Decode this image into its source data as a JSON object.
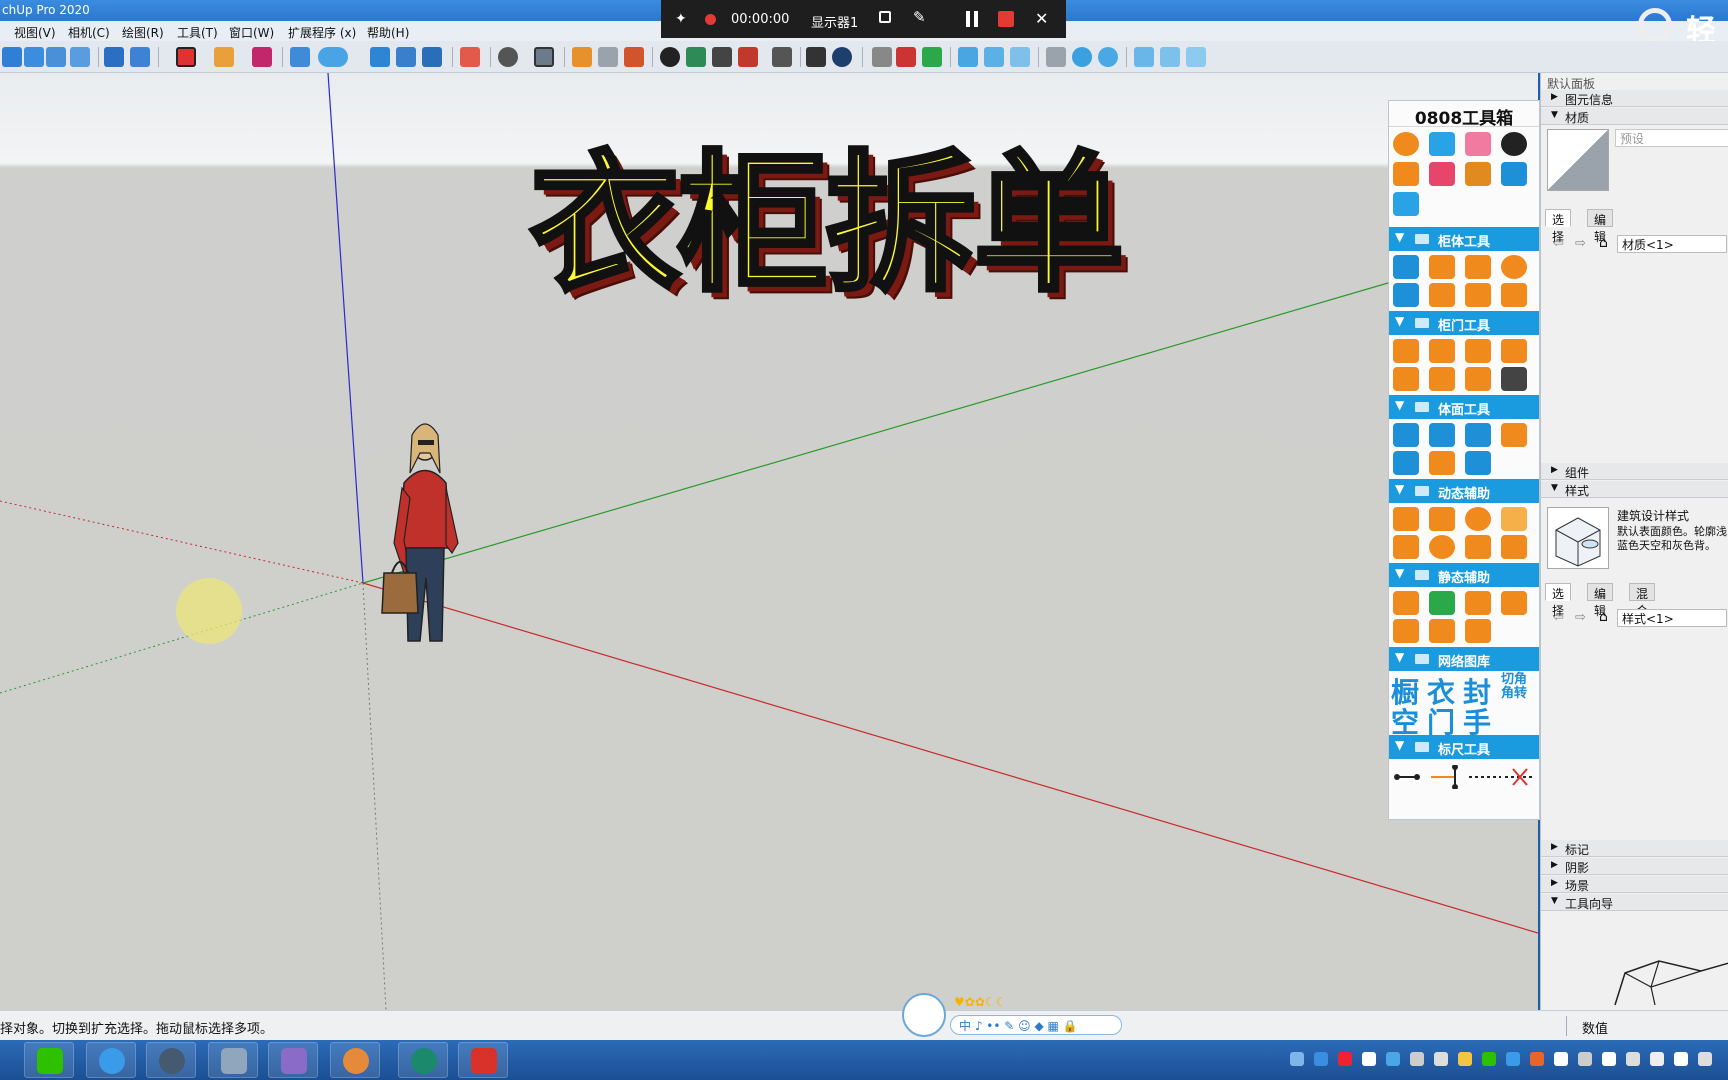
{
  "window": {
    "title": "chUp Pro 2020",
    "brand": "轻"
  },
  "menu": [
    "视图(V)",
    "相机(C)",
    "绘图(R)",
    "工具(T)",
    "窗口(W)",
    "扩展程序 (x)",
    "帮助(H)"
  ],
  "recorder": {
    "timer": "00:00:00",
    "monitor": "显示器1"
  },
  "overlay_title": "衣柜拆单",
  "toolbox": {
    "title": "0808工具箱",
    "sections": [
      "柜体工具",
      "柜门工具",
      "体面工具",
      "动态辅助",
      "静态辅助",
      "网络图库",
      "标尺工具"
    ],
    "library_chars": [
      "橱",
      "衣",
      "封",
      "切角",
      "角转",
      "空",
      "门",
      "手"
    ]
  },
  "tray": {
    "header": "默认面板",
    "entity_info": "图元信息",
    "materials": "材质",
    "preset_placeholder": "预设",
    "tab_select": "选择",
    "tab_edit": "编辑",
    "tab_mix": "混合",
    "material_field": "材质<1>",
    "components": "组件",
    "styles": "样式",
    "style_name": "建筑设计样式",
    "style_desc": "默认表面颜色。轮廓浅蓝色天空和灰色背。",
    "style_field": "样式<1>",
    "tags": "标记",
    "shadows": "阴影",
    "scenes": "场景",
    "instructor": "工具向导"
  },
  "status": {
    "message": "择对象。切换到扩充选择。拖动鼠标选择多项。",
    "vcb_label": "数值"
  },
  "ime": {
    "bar_text": "中 ♪ •• ✎ ☺ ◆ ▦ 🔒"
  },
  "colors": {
    "accent": "#1a9be0",
    "toolbox_icon": "#f08a1c",
    "title_fill": "#fdfb2f"
  }
}
